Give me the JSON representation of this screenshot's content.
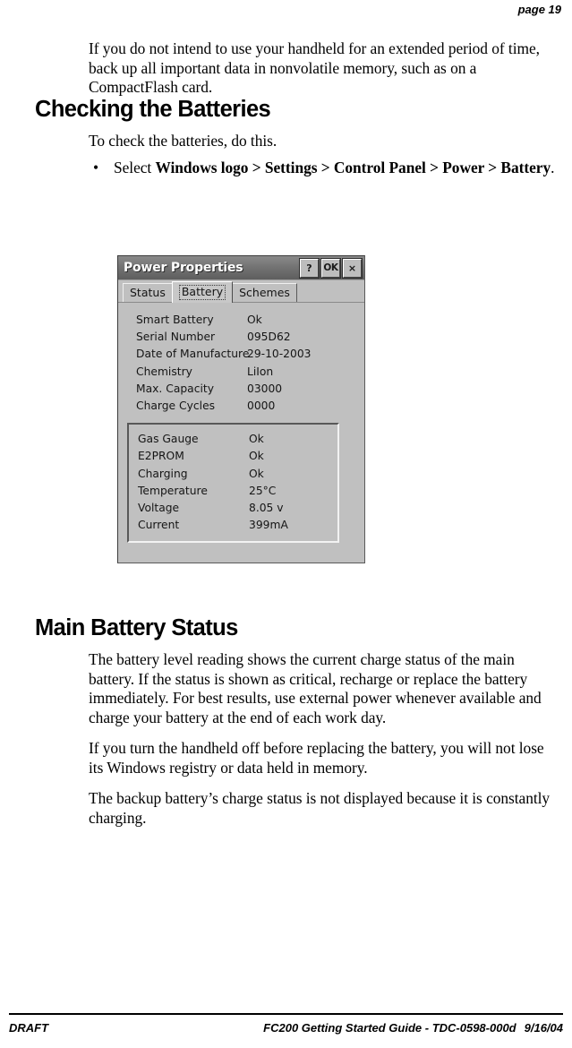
{
  "header": {
    "folio": "page 19"
  },
  "content": {
    "intro_paragraph": "If you do not intend to use your handheld for an extended period of time, back up all important data in nonvolatile memory, such as on a CompactFlash card.",
    "heading_checking": "Checking the Batteries",
    "checking_intro": "To check the batteries, do this.",
    "bullet": {
      "marker": "•",
      "lead": "Select ",
      "path": "Windows logo > Settings > Control Panel > Power > Battery",
      "trail": "."
    },
    "heading_main_battery": "Main Battery Status",
    "paragraph_1": "The battery level reading shows the current charge status of the main battery. If the status is shown as critical, recharge or replace the battery immediately. For best results, use external power whenever available and charge your battery at the end of each work day.",
    "paragraph_2": "If you turn the handheld off before replacing the battery, you will not lose its Windows registry or data held in memory.",
    "paragraph_3": "The backup battery’s charge status is not displayed because it is constantly charging."
  },
  "figure": {
    "dialog": {
      "title": "Power Properties",
      "title_buttons": [
        {
          "name": "help-button",
          "label": "?"
        },
        {
          "name": "ok-button",
          "label": "OK"
        },
        {
          "name": "close-button",
          "label": "×"
        }
      ],
      "tabs": [
        {
          "label": "Status",
          "selected": false
        },
        {
          "label": "Battery",
          "selected": true
        },
        {
          "label": "Schemes",
          "selected": false
        }
      ],
      "battery_info": [
        {
          "key": "Smart Battery",
          "value": "Ok"
        },
        {
          "key": "Serial Number",
          "value": "095D62"
        },
        {
          "key": "Date of Manufacture",
          "value": "29-10-2003"
        },
        {
          "key": "Chemistry",
          "value": "LiIon"
        },
        {
          "key": "Max. Capacity",
          "value": "03000"
        },
        {
          "key": "Charge Cycles",
          "value": "0000"
        }
      ],
      "battery_status_group": [
        {
          "key": "Gas Gauge",
          "value": "Ok"
        },
        {
          "key": "E2PROM",
          "value": "Ok"
        },
        {
          "key": "Charging",
          "value": "Ok"
        },
        {
          "key": "Temperature",
          "value": "25°C"
        },
        {
          "key": "Voltage",
          "value": "8.05 v"
        },
        {
          "key": "Current",
          "value": "399mA"
        }
      ]
    }
  },
  "footer": {
    "left": "DRAFT",
    "doc_title": "FC200 Getting Started Guide - TDC-0598-000d",
    "doc_date": "9/16/04"
  },
  "colors": {
    "page_background": "#ffffff",
    "text": "#000000",
    "dialog_face": "#c0c0c0",
    "dialog_titlebar": "#6e6e6e",
    "dialog_titlebar_text": "#ffffff"
  }
}
